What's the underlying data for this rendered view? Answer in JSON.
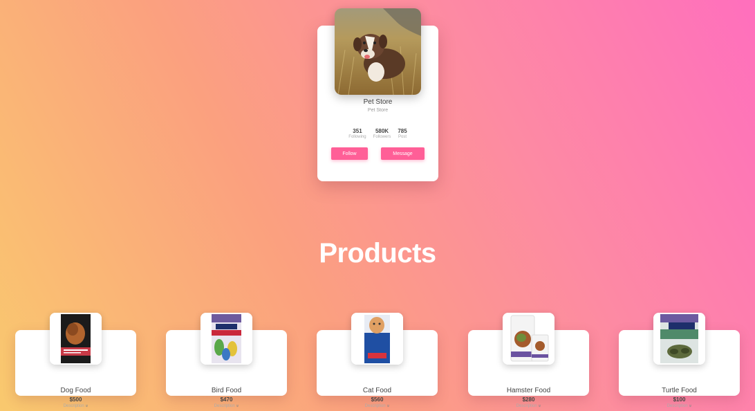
{
  "profile": {
    "name": "Pet Store",
    "subtitle": "Pet Store",
    "photo_icon": "dog-photo",
    "stats": [
      {
        "value": "351",
        "label": "Following"
      },
      {
        "value": "580K",
        "label": "Followers"
      },
      {
        "value": "785",
        "label": "Post"
      }
    ],
    "follow_label": "Follow",
    "message_label": "Message"
  },
  "section_title": "Products",
  "products": [
    {
      "name": "Dog Food",
      "price": "$500",
      "description_label": "Description",
      "chevron": "»"
    },
    {
      "name": "Bird Food",
      "price": "$470",
      "description_label": "Description",
      "chevron": "»"
    },
    {
      "name": "Cat Food",
      "price": "$560",
      "description_label": "Description",
      "chevron": "»"
    },
    {
      "name": "Hamster Food",
      "price": "$280",
      "description_label": "Description",
      "chevron": "»"
    },
    {
      "name": "Turtle Food",
      "price": "$100",
      "description_label": "Description",
      "chevron": "»"
    }
  ],
  "colors": {
    "accent": "#ff5f97",
    "card": "#ffffff",
    "text": "#444444",
    "muted": "#aaaaaa"
  }
}
